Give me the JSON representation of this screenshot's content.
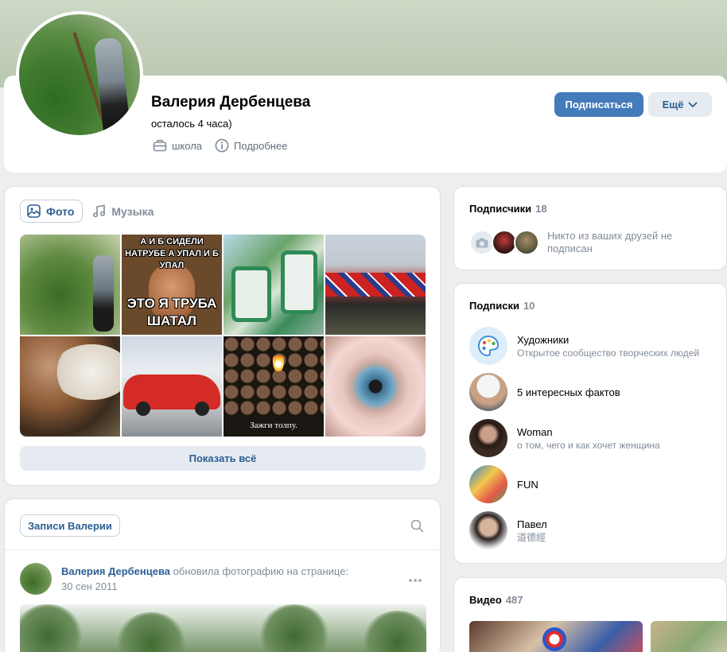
{
  "profile": {
    "name": "Валерия Дербенцева",
    "status": "осталось 4 часа)",
    "school_label": "школа",
    "details_label": "Подробнее",
    "subscribe_label": "Подписаться",
    "more_label": "Ещё"
  },
  "photos": {
    "tabs": [
      {
        "label": "Фото",
        "icon": "image-icon",
        "active": true
      },
      {
        "label": "Музыка",
        "icon": "music-note-icon",
        "active": false
      }
    ],
    "meme_top": "А И Б СИДЕЛИ НАТРУБЕ А УПАЛ И Б УПАЛ",
    "meme_bottom": "ЭТО Я ТРУБА ШАТАЛ",
    "matches_caption": "Зажги толпу.",
    "show_all_label": "Показать всё"
  },
  "wall": {
    "tab_label": "Записи Валерии",
    "post": {
      "author": "Валерия Дербенцева",
      "action": " обновила фотографию на странице:",
      "date": "30 сен 2011"
    }
  },
  "followers": {
    "title": "Подписчики",
    "count": "18",
    "note": "Никто из ваших друзей не подписан"
  },
  "subscriptions": {
    "title": "Подписки",
    "count": "10",
    "items": [
      {
        "name": "Художники",
        "desc": "Открытое сообщество творческих людей"
      },
      {
        "name": "5 интересных фактов",
        "desc": ""
      },
      {
        "name": "Woman",
        "desc": "о том, чего и как хочет женщина"
      },
      {
        "name": "FUN",
        "desc": ""
      },
      {
        "name": "Павел",
        "desc": "道德經"
      }
    ]
  },
  "videos": {
    "title": "Видео",
    "count": "487"
  },
  "colors": {
    "accent": "#447bba",
    "link": "#2c5f93",
    "background": "#edeef0",
    "secondary_text": "#818c99"
  }
}
